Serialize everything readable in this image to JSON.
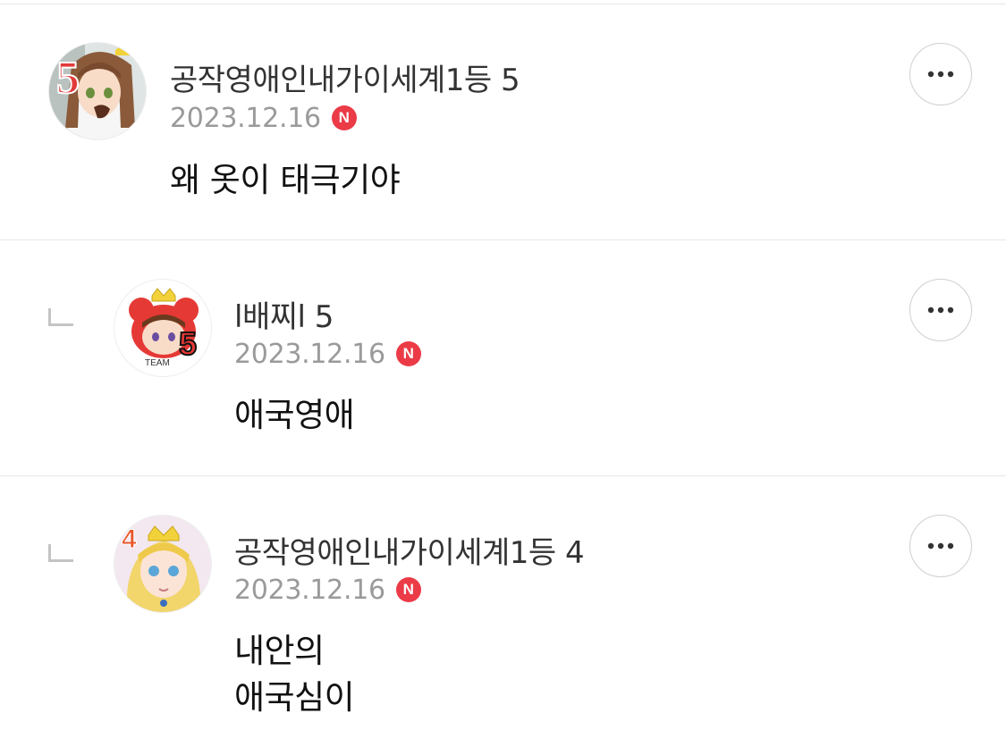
{
  "comments": [
    {
      "author": "공작영애인내가이세계1등 5",
      "date": "2023.12.16",
      "badge": "N",
      "lines": [
        "왜 옷이 태극기야"
      ],
      "avatar": "avatar-girl-brown-hair-5"
    },
    {
      "author": "l배찌l 5",
      "date": "2023.12.16",
      "badge": "N",
      "lines": [
        "애국영애"
      ],
      "avatar": "avatar-team-bazzi-5"
    },
    {
      "author": "공작영애인내가이세계1등 4",
      "date": "2023.12.16",
      "badge": "N",
      "lines": [
        "내안의",
        "애국심이"
      ],
      "avatar": "avatar-blonde-princess-4"
    }
  ],
  "colors": {
    "badge": "#eb3b47",
    "author": "#333333",
    "date": "#9a9a9a",
    "divider": "#e6e6e6"
  },
  "icons": {
    "more": "more-dots-icon",
    "reply": "reply-corner-icon"
  }
}
